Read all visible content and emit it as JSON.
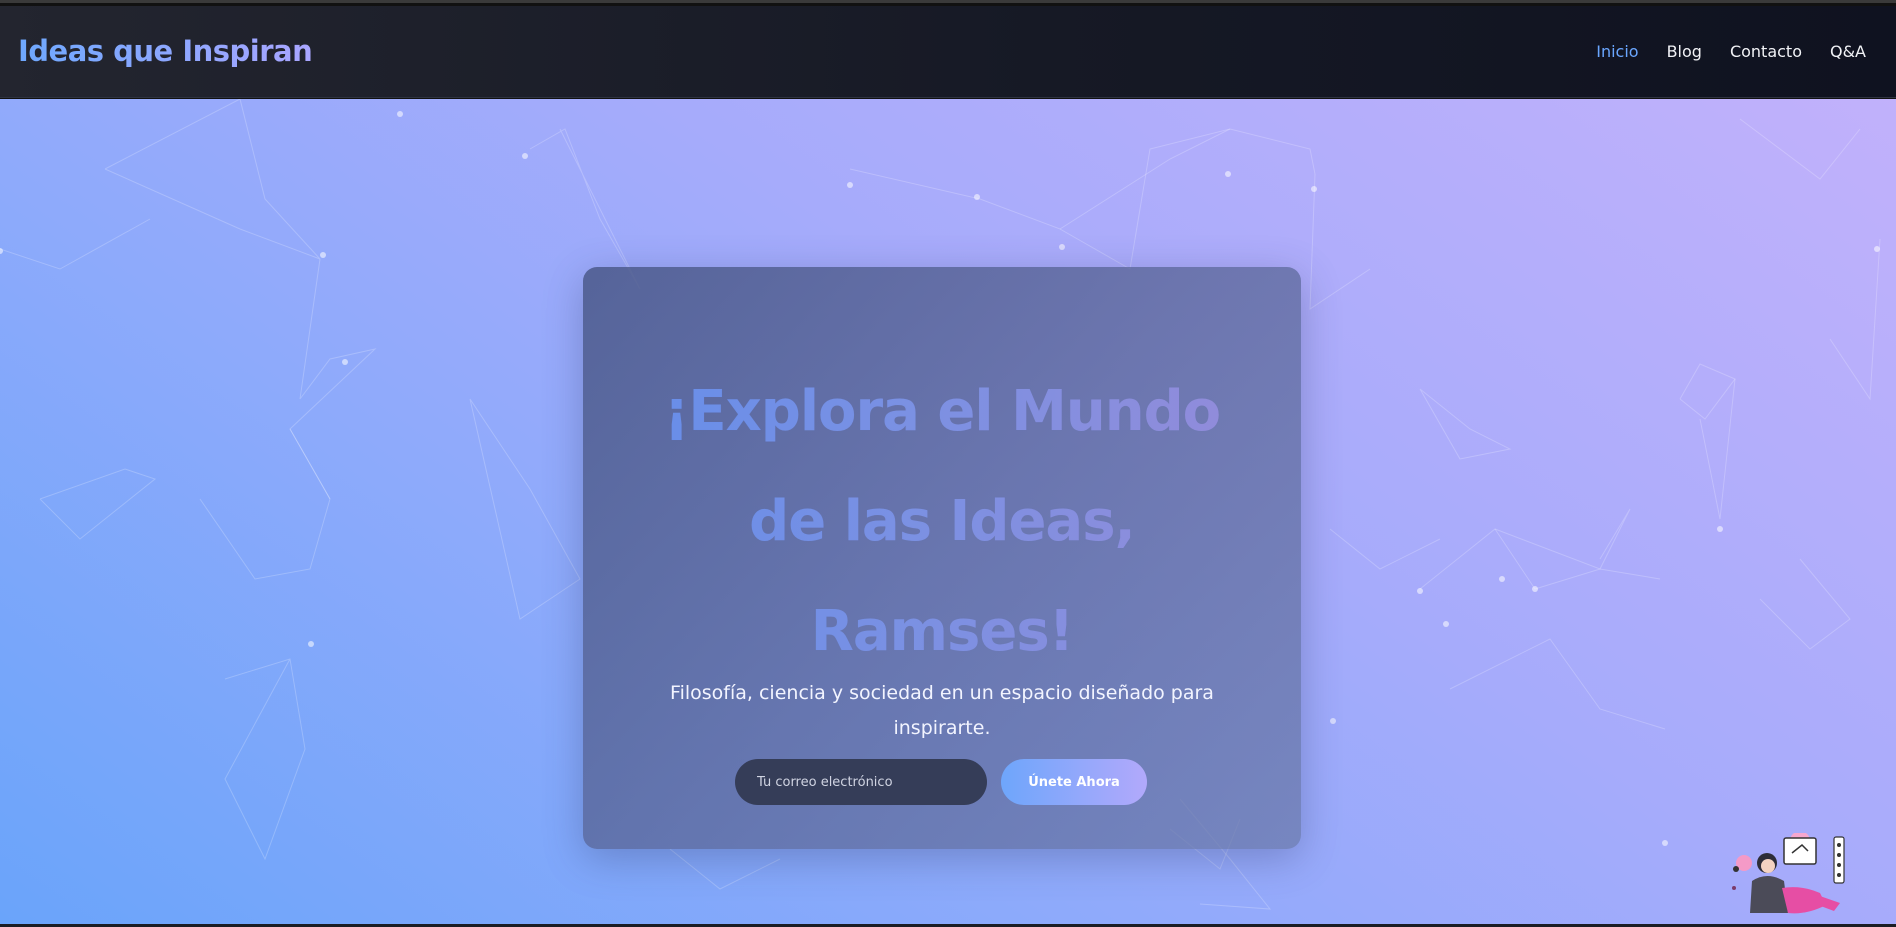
{
  "header": {
    "brand": "Ideas que Inspiran",
    "nav": [
      {
        "label": "Inicio",
        "active": true
      },
      {
        "label": "Blog",
        "active": false
      },
      {
        "label": "Contacto",
        "active": false
      },
      {
        "label": "Q&A",
        "active": false
      }
    ]
  },
  "hero": {
    "headline_lines": [
      "¡Explora el Mundo",
      "de las Ideas,",
      "Ramses!"
    ],
    "subtitle": "Filosofía, ciencia y sociedad en un espacio diseñado para inspirarte.",
    "email_placeholder": "Tu correo electrónico",
    "email_value": "",
    "join_label": "Únete Ahora"
  },
  "colors": {
    "accent": "#6aa6ff",
    "gradient_start": "#6aa4fa",
    "gradient_end": "#c1b1fb",
    "navbar": "#161925"
  },
  "icons": [
    "artist-mascot-icon"
  ]
}
